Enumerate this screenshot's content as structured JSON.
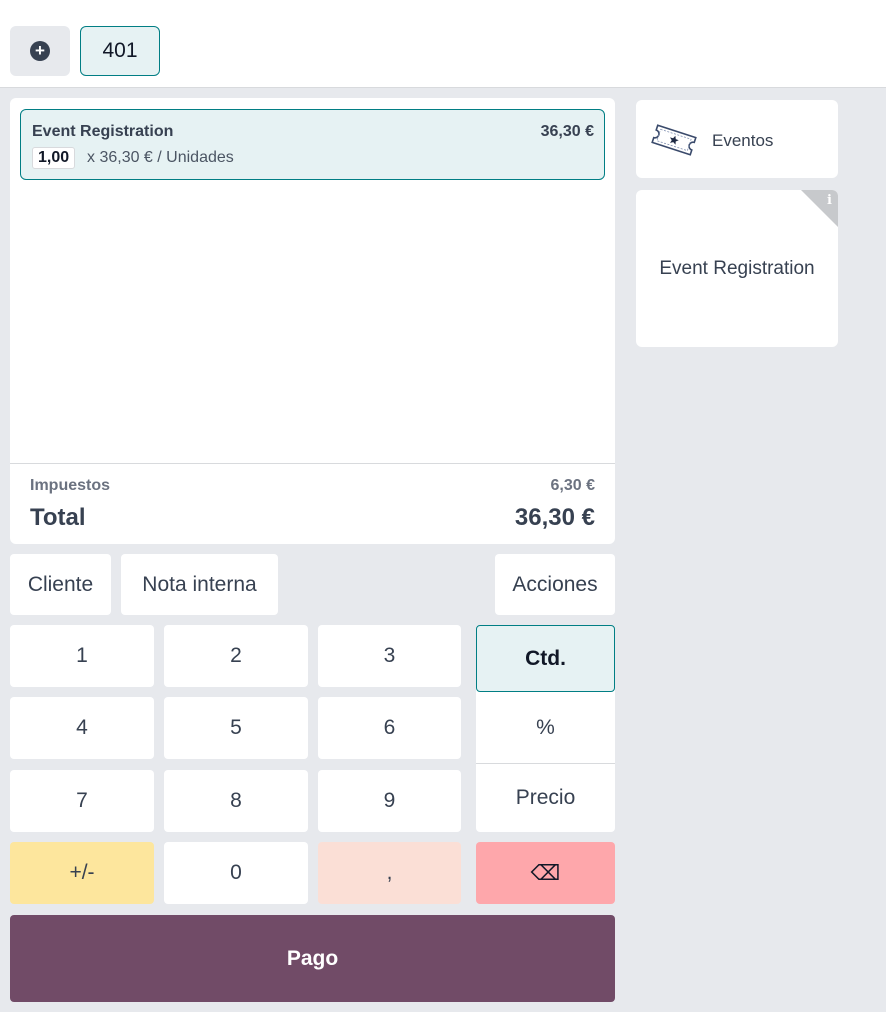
{
  "topbar": {
    "add_icon": "plus-circle-icon",
    "order_tab": "401"
  },
  "order": {
    "lines": [
      {
        "name": "Event Registration",
        "price": "36,30 €",
        "qty": "1,00",
        "unit_price": "x 36,30 € / Unidades"
      }
    ],
    "tax_label": "Impuestos",
    "tax_value": "6,30 €",
    "total_label": "Total",
    "total_value": "36,30 €"
  },
  "controls": {
    "customer": "Cliente",
    "note": "Nota interna",
    "actions": "Acciones"
  },
  "numpad": {
    "keys": [
      "1",
      "2",
      "3",
      "4",
      "5",
      "6",
      "7",
      "8",
      "9",
      "+/-",
      "0",
      ","
    ],
    "modes": {
      "qty": "Ctd.",
      "discount": "%",
      "price": "Precio"
    },
    "backspace": "⌫"
  },
  "payment": {
    "label": "Pago"
  },
  "categories": [
    {
      "label": "Eventos",
      "icon": "ticket-icon"
    }
  ],
  "products": [
    {
      "name": "Event Registration",
      "info_icon": "info-icon"
    }
  ],
  "colors": {
    "accent": "#017e84",
    "selected_bg": "#e6f2f3",
    "pay": "#714b67",
    "sign_key": "#fde69d",
    "decimal_key": "#fbdfd6",
    "backspace_key": "#fea7ab",
    "background": "#e7e9ed"
  }
}
